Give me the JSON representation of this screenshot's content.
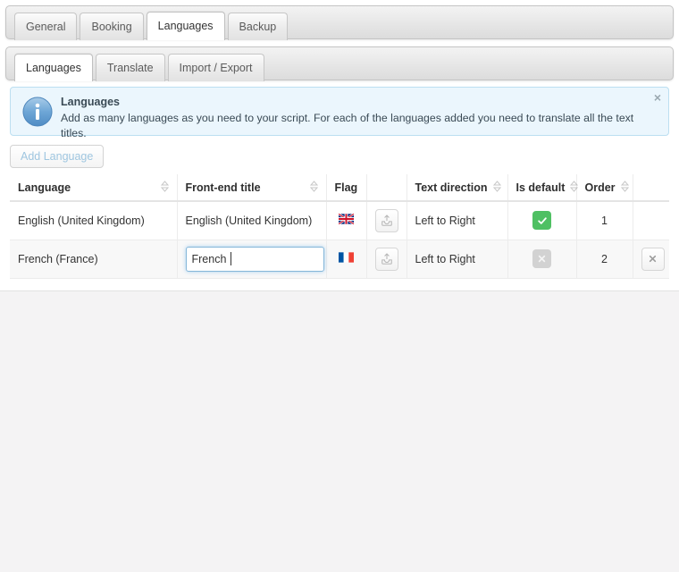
{
  "top_tabs": {
    "items": [
      {
        "label": "General",
        "active": false
      },
      {
        "label": "Booking",
        "active": false
      },
      {
        "label": "Languages",
        "active": true
      },
      {
        "label": "Backup",
        "active": false
      }
    ]
  },
  "sub_tabs": {
    "items": [
      {
        "label": "Languages",
        "active": true
      },
      {
        "label": "Translate",
        "active": false
      },
      {
        "label": "Import / Export",
        "active": false
      }
    ]
  },
  "alert": {
    "icon": "info-icon",
    "title": "Languages",
    "text": "Add as many languages as you need to your script. For each of the languages added you need to translate all the text titles.",
    "close_label": "×",
    "bg_color": "#ebf6fd",
    "border_color": "#bcdff1"
  },
  "toolbar": {
    "add_language_label": "Add Language"
  },
  "table": {
    "columns": [
      {
        "label": "Language",
        "sortable": true
      },
      {
        "label": "Front-end title",
        "sortable": true
      },
      {
        "label": "Flag",
        "sortable": false
      },
      {
        "label": "",
        "sortable": false
      },
      {
        "label": "Text direction",
        "sortable": true
      },
      {
        "label": "Is default",
        "sortable": true
      },
      {
        "label": "Order",
        "sortable": true
      },
      {
        "label": "",
        "sortable": false
      }
    ],
    "rows": [
      {
        "language": "English (United Kingdom)",
        "frontend_title": "English (United Kingdom)",
        "frontend_editing": false,
        "flag": "flag-uk",
        "upload_icon": "upload-image-icon",
        "text_direction": "Left to Right",
        "is_default": true,
        "is_default_icon": "check-badge-icon",
        "order": "1",
        "deletable": false
      },
      {
        "language": "French (France)",
        "frontend_title": "French ",
        "frontend_editing": true,
        "flag": "flag-fr",
        "upload_icon": "upload-image-icon",
        "text_direction": "Left to Right",
        "is_default": false,
        "is_default_icon": "cross-badge-icon",
        "order": "2",
        "deletable": true,
        "delete_label": "✖"
      }
    ]
  },
  "colors": {
    "page_bg": "#f4f3f4",
    "panel_bg": "#ffffff",
    "accent_blue": "#86b7d9",
    "default_on": "#4fc063",
    "default_off": "#d2d2d2"
  }
}
